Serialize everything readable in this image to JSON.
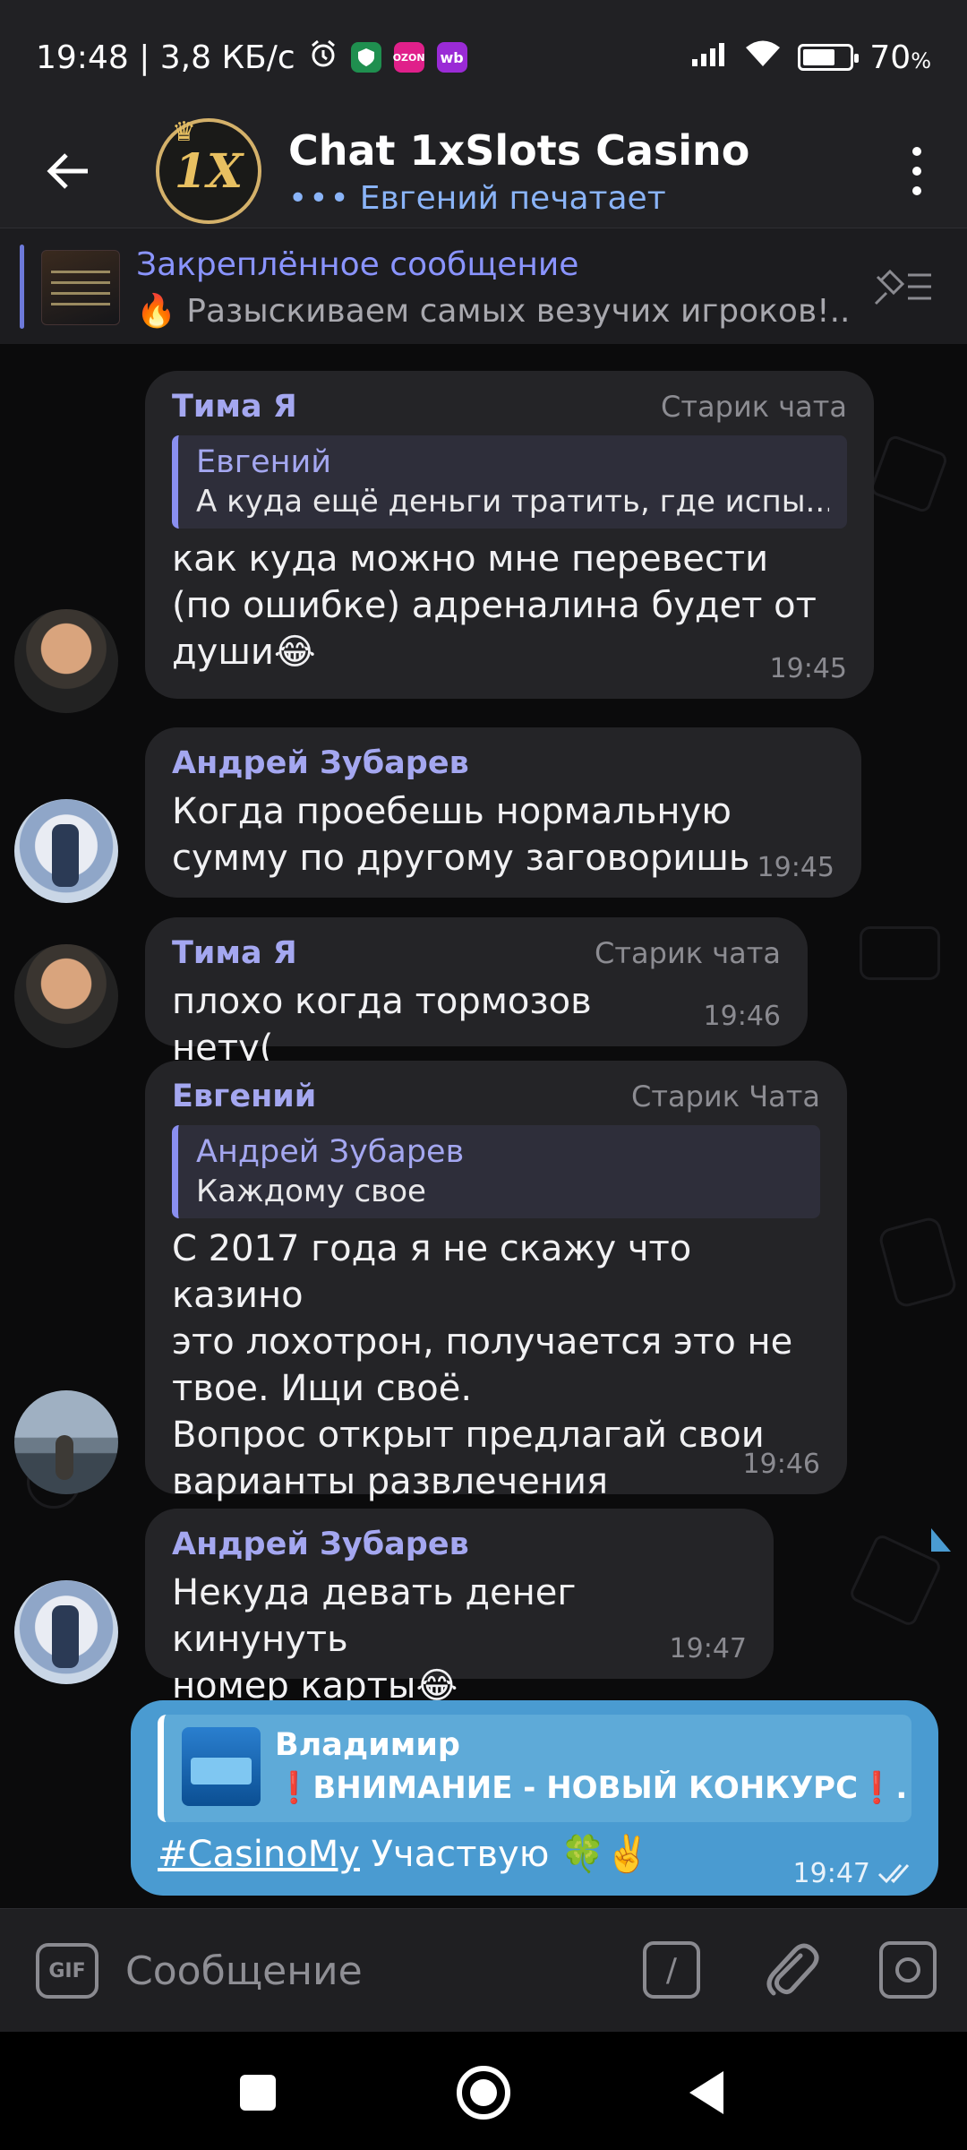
{
  "status_bar": {
    "time_speed": "19:48 | 3,8 КБ/с",
    "battery": "70",
    "battery_unit": "%",
    "battery_level": 0.7,
    "app_icons": [
      "alarm-icon",
      "shield-icon",
      "ozon-icon",
      "wb-icon"
    ],
    "ozon_label": "OZON",
    "wb_label": "wb"
  },
  "header": {
    "title": "Chat 1xSlots Casino",
    "typing": "Евгений печатает",
    "logo_text": "1X",
    "icons": [
      "back-arrow-icon",
      "more-vert-icon"
    ]
  },
  "pinned": {
    "title": "Закреплённое сообщение",
    "emoji": "🔥",
    "text": "Разыскиваем самых везучих игроков!..."
  },
  "messages": [
    {
      "sender": "Тима Я",
      "rank": "Старик чата",
      "quote_name": "Евгений",
      "quote_text": "А куда ещё деньги тратить, где испы...",
      "text": "как куда можно мне перевести\n(по ошибке) адреналина будет от\nдуши😂",
      "time": "19:45"
    },
    {
      "sender": "Андрей Зубарев",
      "text": "Когда проебешь нормальную\nсумму по другому заговоришь",
      "time": "19:45"
    },
    {
      "sender": "Тима Я",
      "rank": "Старик чата",
      "text": "плохо когда тормозов нету(",
      "time": "19:46"
    },
    {
      "sender": "Евгений",
      "rank": "Старик Чата",
      "quote_name": "Андрей Зубарев",
      "quote_text": "Каждому свое",
      "text": "С 2017 года я не скажу что казино\nэто лохотрон, получается это не\nтвое. Ищи своё.\nВопрос открыт предлагай свои\nварианты развлечения",
      "time": "19:46"
    },
    {
      "sender": "Андрей Зубарев",
      "text": "Некуда девать денег кинунуть\nномер карты😂",
      "time": "19:47"
    }
  ],
  "own_message": {
    "quote_name": "Владимир",
    "quote_text": "❗ВНИМАНИЕ - НОВЫЙ КОНКУРС❗...",
    "hashtag": "#CasinoMy",
    "text": " Участвую 🍀✌️",
    "time": "19:47",
    "status": "read"
  },
  "input": {
    "placeholder": "Сообщение",
    "gif_label": "GIF",
    "command_label": "/",
    "icons": [
      "gif-icon",
      "command-icon",
      "attach-icon",
      "camera-icon"
    ]
  },
  "colors": {
    "accent": "#a4a7f0",
    "own_bubble": "#4a9bd1",
    "bubble": "#242427",
    "header": "#212124"
  }
}
